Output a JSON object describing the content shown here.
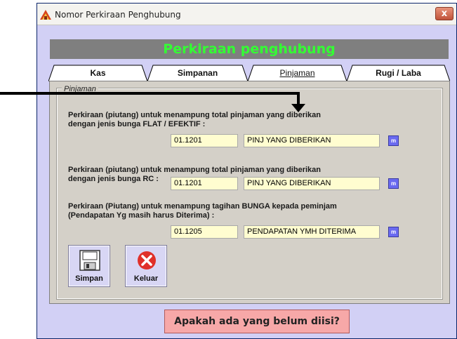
{
  "window": {
    "title": "Nomor Perkiraan Penghubung",
    "close_label": "x"
  },
  "header": {
    "title": "Perkiraan penghubung"
  },
  "tabs": [
    {
      "label": "Kas",
      "active": false
    },
    {
      "label": "Simpanan",
      "active": false
    },
    {
      "label": "Pinjaman",
      "active": true
    },
    {
      "label": "Rugi / Laba",
      "active": false
    }
  ],
  "panel": {
    "group_label": "Pinjaman",
    "sections": [
      {
        "desc_line1": "Perkiraan (piutang) untuk menampung total pinjaman yang diberikan",
        "desc_line2": "dengan jenis bunga FLAT / EFEKTIF :",
        "code": "01.1201",
        "name": "PINJ YANG DIBERIKAN",
        "lookup": "m"
      },
      {
        "desc_line1": "Perkiraan (piutang) untuk menampung total pinjaman yang diberikan",
        "desc_line2": "dengan jenis bunga RC :",
        "code": "01.1201",
        "name": "PINJ YANG DIBERIKAN",
        "lookup": "m"
      },
      {
        "desc_line1": "Perkiraan (Piutang) untuk menampung tagihan BUNGA kepada peminjam",
        "desc_line2": "(Pendapatan Yg masih harus Diterima) :",
        "code": "01.1205",
        "name": "PENDAPATAN YMH DITERIMA",
        "lookup": "m"
      }
    ]
  },
  "buttons": {
    "save_label": "Simpan",
    "exit_label": "Keluar"
  },
  "footer": {
    "hint_label": "Apakah ada yang belum diisi?"
  },
  "colors": {
    "window_bg": "#d2d0f5",
    "banner_bg": "#7f7f7f",
    "banner_text": "#33ff33",
    "field_bg": "#fffdd0",
    "lookup_bg": "#6a6af0",
    "hint_bg": "#f7a8a8",
    "exit_icon": "#e0302a"
  },
  "icons": {
    "app": "app-icon",
    "save": "floppy-disk-icon",
    "exit": "close-circle-icon",
    "annotation": "arrow-pointer-icon"
  }
}
